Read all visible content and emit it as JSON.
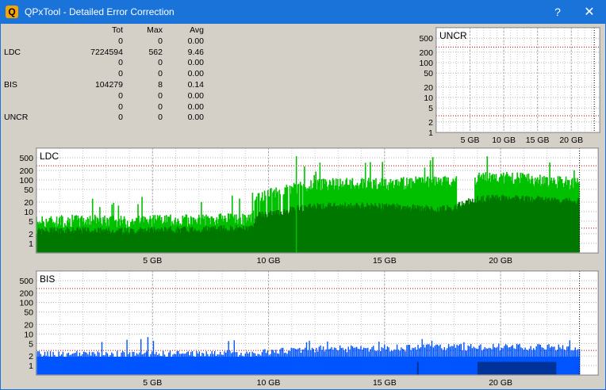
{
  "window": {
    "title": "QPxTool - Detailed Error Correction",
    "help_label": "?",
    "close_label": "✕",
    "app_icon_letter": "Q"
  },
  "stats": {
    "headers": [
      "",
      "Tot",
      "Max",
      "Avg"
    ],
    "rows": [
      [
        "",
        "0",
        "0",
        "0.00"
      ],
      [
        "LDC",
        "7224594",
        "562",
        "9.46"
      ],
      [
        "",
        "0",
        "0",
        "0.00"
      ],
      [
        "",
        "0",
        "0",
        "0.00"
      ],
      [
        "BIS",
        "104279",
        "8",
        "0.14"
      ],
      [
        "",
        "0",
        "0",
        "0.00"
      ],
      [
        "",
        "0",
        "0",
        "0.00"
      ],
      [
        "UNCR",
        "0",
        "0",
        "0.00"
      ]
    ]
  },
  "chart_data": [
    {
      "id": "uncr",
      "type": "area",
      "title": "UNCR",
      "y_scale": "log",
      "y_ticks": [
        500,
        200,
        100,
        50,
        20,
        10,
        5,
        2,
        1
      ],
      "x_ticks": [
        "5 GB",
        "10 GB",
        "15 GB",
        "20 GB"
      ],
      "x_tick_values": [
        5,
        10,
        15,
        20
      ],
      "xlim": [
        0,
        24.2
      ],
      "ylim": [
        1,
        1000
      ],
      "red_lines": [
        280,
        3
      ],
      "end_marker": 23.4,
      "series": []
    },
    {
      "id": "ldc",
      "type": "area",
      "title": "LDC",
      "y_scale": "log",
      "y_ticks": [
        500,
        200,
        100,
        50,
        20,
        10,
        5,
        2,
        1
      ],
      "x_ticks": [
        "5 GB",
        "10 GB",
        "15 GB",
        "20 GB"
      ],
      "x_tick_values": [
        5,
        10,
        15,
        20
      ],
      "xlim": [
        0,
        24.2
      ],
      "ylim": [
        0.5,
        1000
      ],
      "red_lines": [
        280,
        3
      ],
      "end_marker": 23.4,
      "max_value": 562,
      "colors": {
        "max": "#00c000",
        "avg": "#007800"
      },
      "series": [
        {
          "name": "max",
          "x": [
            0,
            2,
            4,
            6,
            8,
            9.3,
            9.6,
            10.5,
            11,
            12,
            13,
            14,
            15,
            16,
            17,
            18,
            18.5,
            19,
            20,
            21,
            22,
            23.4
          ],
          "values": [
            5,
            5.5,
            5,
            5.5,
            6,
            6,
            30,
            45,
            55,
            70,
            80,
            80,
            75,
            85,
            90,
            95,
            110,
            120,
            130,
            110,
            95,
            80
          ]
        },
        {
          "name": "avg",
          "x": [
            0,
            2,
            4,
            6,
            8,
            9.3,
            9.6,
            10.5,
            11,
            12,
            13,
            14,
            15,
            16,
            17,
            18,
            18.5,
            19,
            20,
            21,
            22,
            23.4
          ],
          "values": [
            2.5,
            2.7,
            2.5,
            2.8,
            3,
            3,
            8,
            10,
            12,
            15,
            16,
            16,
            15,
            14,
            13,
            13,
            20,
            25,
            28,
            26,
            24,
            22
          ]
        }
      ]
    },
    {
      "id": "bis",
      "type": "bar",
      "title": "BIS",
      "y_scale": "log",
      "y_ticks": [
        500,
        200,
        100,
        50,
        20,
        10,
        5,
        2,
        1
      ],
      "x_ticks": [
        "5 GB",
        "10 GB",
        "15 GB",
        "20 GB"
      ],
      "x_tick_values": [
        5,
        10,
        15,
        20
      ],
      "xlim": [
        0,
        24.2
      ],
      "ylim": [
        0.5,
        1000
      ],
      "red_lines": [
        280,
        3
      ],
      "end_marker": 23.4,
      "max_value": 8,
      "colors": {
        "bars": "#0055ff",
        "dark": "#003399"
      },
      "series": [
        {
          "name": "bis",
          "x": [
            0,
            5,
            9.5,
            12,
            15,
            19,
            23.4
          ],
          "values": [
            2,
            2,
            2.2,
            3,
            3.2,
            3.5,
            3.2
          ]
        }
      ]
    }
  ]
}
